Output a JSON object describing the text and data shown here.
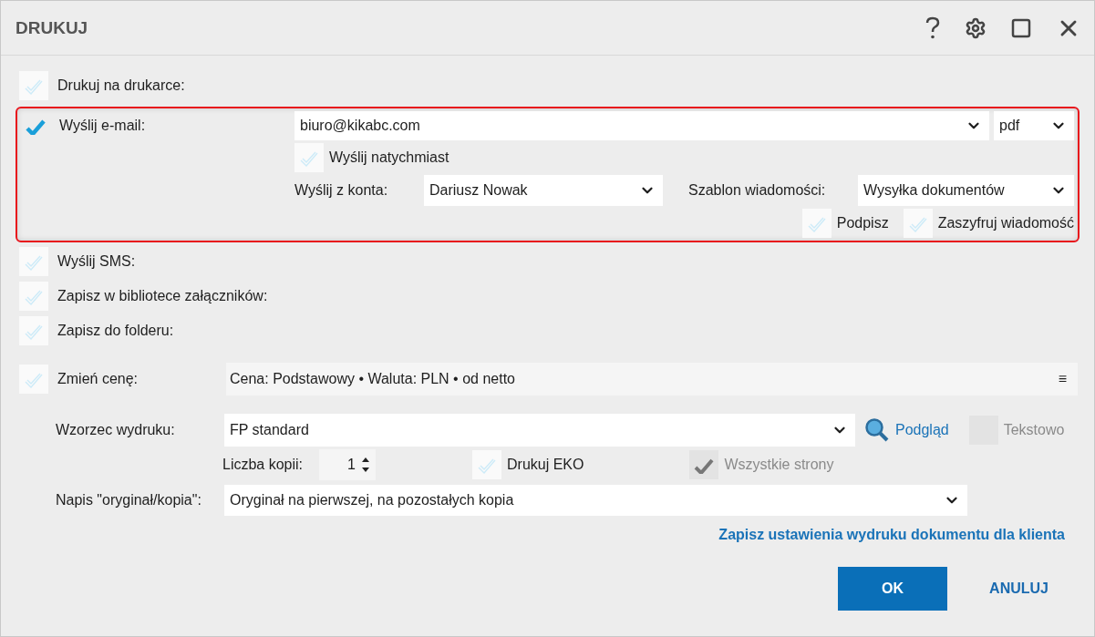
{
  "window": {
    "title": "DRUKUJ"
  },
  "printer": {
    "label": "Drukuj na drukarce:",
    "checked": false
  },
  "email": {
    "label": "Wyślij e-mail:",
    "checked": true,
    "highlighted": true,
    "address": "biuro@kikabc.com",
    "format": "pdf",
    "send_now": {
      "label": "Wyślij natychmiast",
      "checked": false
    },
    "account_label": "Wyślij z konta:",
    "account": "Dariusz Nowak",
    "template_label": "Szablon wiadomości:",
    "template": "Wysyłka dokumentów",
    "sign": {
      "label": "Podpisz",
      "checked": false
    },
    "encrypt": {
      "label": "Zaszyfruj wiadomość",
      "checked": false
    }
  },
  "options": [
    {
      "label": "Wyślij SMS:",
      "checked": false
    },
    {
      "label": "Zapisz w bibliotece załączników:",
      "checked": false
    },
    {
      "label": "Zapisz do folderu:",
      "checked": false
    }
  ],
  "price": {
    "label": "Zmień cenę:",
    "checked": false,
    "value": "Cena: Podstawowy • Waluta: PLN • od netto",
    "menu": "≡"
  },
  "print_template": {
    "label": "Wzorzec wydruku:",
    "value": "FP standard",
    "preview_link": "Podgląd"
  },
  "text_mode": {
    "label": "Tekstowo",
    "checked": false,
    "disabled": true
  },
  "copies": {
    "label": "Liczba kopii:",
    "value": "1"
  },
  "eko": {
    "label": "Drukuj EKO",
    "checked": false,
    "disabled": false
  },
  "all_pages": {
    "label": "Wszystkie strony",
    "checked": true,
    "disabled": true
  },
  "caption": {
    "label": "Napis \"oryginał/kopia\":",
    "value": "Oryginał na pierwszej, na pozostałych kopia"
  },
  "save_link": "Zapisz ustawienia wydruku dokumentu dla klienta",
  "buttons": [
    {
      "label": "OK",
      "kind": "primary"
    },
    {
      "label": "ANULUJ",
      "kind": "secondary"
    }
  ]
}
